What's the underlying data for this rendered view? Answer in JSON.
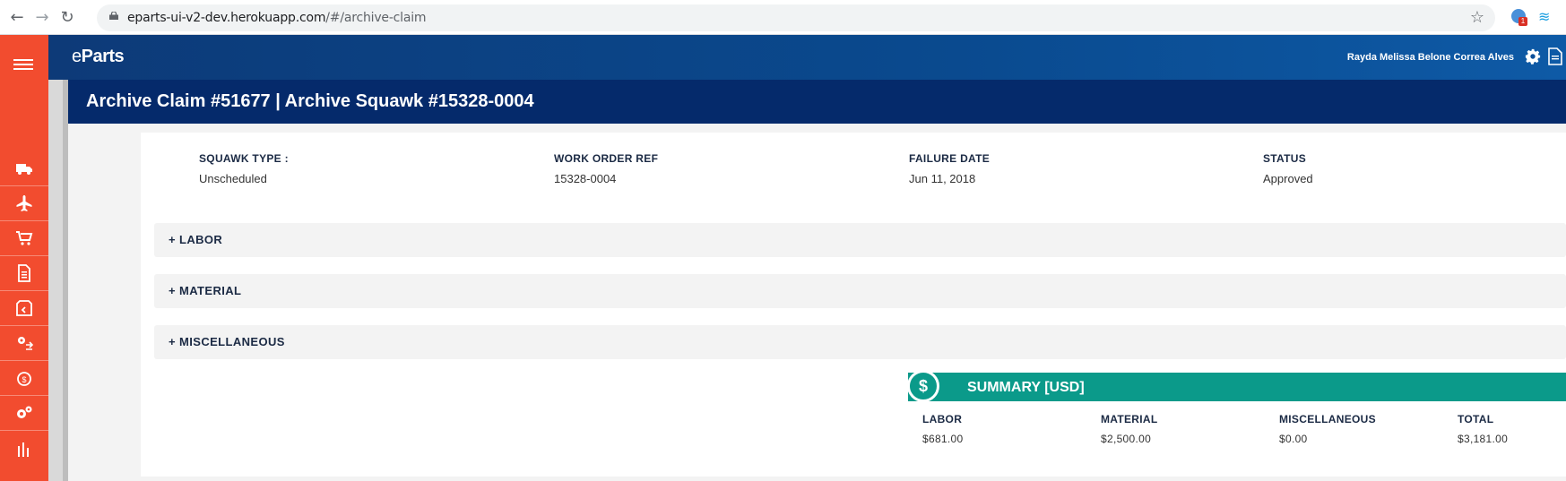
{
  "browser": {
    "url_domain": "eparts-ui-v2-dev.herokuapp.com",
    "url_path": "/#/archive-claim",
    "extension_badge": "1"
  },
  "app": {
    "brand_e": "e",
    "brand_rest": "Parts",
    "user_name": "Rayda Melissa Belone Correa Alves"
  },
  "page": {
    "title": "Archive Claim #51677 | Archive Squawk #15328-0004"
  },
  "details": {
    "squawk_type_label": "SQUAWK TYPE :",
    "squawk_type_value": "Unscheduled",
    "work_order_label": "WORK ORDER REF",
    "work_order_value": "15328-0004",
    "failure_date_label": "FAILURE DATE",
    "failure_date_value": "Jun 11, 2018",
    "status_label": "STATUS",
    "status_value": "Approved"
  },
  "sections": {
    "labor": "+ LABOR",
    "material": "+ MATERIAL",
    "misc": "+ MISCELLANEOUS"
  },
  "summary": {
    "icon": "$",
    "title": "SUMMARY [USD]",
    "labor_label": "LABOR",
    "labor_value": "$681.00",
    "material_label": "MATERIAL",
    "material_value": "$2,500.00",
    "misc_label": "MISCELLANEOUS",
    "misc_value": "$0.00",
    "total_label": "TOTAL",
    "total_value": "$3,181.00"
  },
  "colors": {
    "sidebar": "#f24c2f",
    "header": "#0d3a78",
    "titlebar": "#052a6b",
    "summary": "#0b9a8a"
  }
}
